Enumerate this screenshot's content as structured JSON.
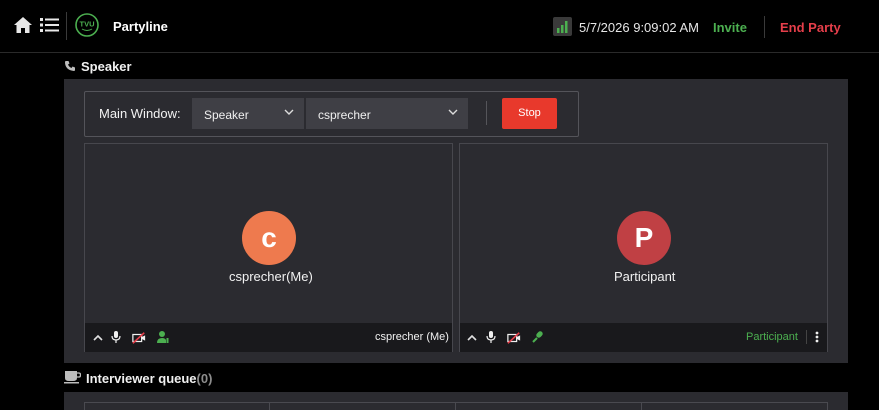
{
  "header": {
    "app_title": "Partyline",
    "datetime": "5/7/2026 9:09:02 AM",
    "invite_label": "Invite",
    "end_party_label": "End Party",
    "logo_text": "TVU"
  },
  "speaker_section": {
    "title": "Speaker",
    "main_window_label": "Main Window:",
    "mode_select_value": "Speaker",
    "user_select_value": "csprecher",
    "stop_label": "Stop"
  },
  "tiles": [
    {
      "avatar_letter": "c",
      "name": "csprecher(Me)",
      "footer_name": "csprecher (Me)",
      "avatar_color": "#ee7a4e"
    },
    {
      "avatar_letter": "P",
      "name": "Participant",
      "footer_name": "Participant",
      "avatar_color": "#c04044"
    }
  ],
  "queue_section": {
    "title": "Interviewer queue",
    "count": "(0)"
  },
  "colors": {
    "invite": "#4caf50",
    "end_party": "#e53e4a",
    "stop_button": "#e8392c",
    "participant_label": "#4caf50"
  }
}
